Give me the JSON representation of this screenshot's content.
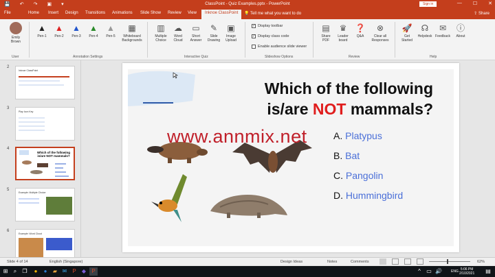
{
  "window": {
    "title": "ClassPoint - Quiz Examples.pptx - PowerPoint",
    "signin": "Sign in",
    "minimize": "—",
    "maximize": "☐",
    "close": "✕"
  },
  "qat": [
    "💾",
    "↶",
    "↷",
    "▣",
    "▾"
  ],
  "tabs": [
    "File",
    "Home",
    "Insert",
    "Design",
    "Transitions",
    "Animations",
    "Slide Show",
    "Review",
    "View",
    "Inknoe ClassPoint"
  ],
  "active_tab": "Inknoe ClassPoint",
  "tell_me": "Tell me what you want to do",
  "share": "Share",
  "ribbon": {
    "user": {
      "name_line1": "Emily",
      "name_line2": "Brown",
      "group": "User"
    },
    "annotation": {
      "pens": [
        "Pen-1",
        "Pen-2",
        "Pen-3",
        "Pen-4",
        "Pen-5"
      ],
      "whiteboard_line1": "Whiteboard",
      "whiteboard_line2": "Backgrounds",
      "group": "Annotation Settings"
    },
    "interactive": {
      "buttons": [
        {
          "line1": "Multiple",
          "line2": "Choice"
        },
        {
          "line1": "Word",
          "line2": "Cloud"
        },
        {
          "line1": "Short",
          "line2": "Answer"
        },
        {
          "line1": "Slide",
          "line2": "Drawing"
        },
        {
          "line1": "Image",
          "line2": "Upload"
        }
      ],
      "group": "Interactive Quiz"
    },
    "slideshow": {
      "options": [
        {
          "label": "Display toolbar",
          "checked": "✓"
        },
        {
          "label": "Display class code",
          "checked": "✓"
        },
        {
          "label": "Enable audience slide viewer",
          "checked": ""
        }
      ],
      "group": "Slideshow Options"
    },
    "review": {
      "buttons": [
        {
          "line1": "Share",
          "line2": "PDF"
        },
        {
          "line1": "Leader",
          "line2": "board"
        },
        {
          "line1": "Q&A",
          "line2": ""
        },
        {
          "line1": "Clear all",
          "line2": "Responses"
        }
      ],
      "group": "Review"
    },
    "help": {
      "buttons": [
        {
          "line1": "Get",
          "line2": "Started"
        },
        {
          "line1": "Helpdesk",
          "line2": ""
        },
        {
          "line1": "Feedback",
          "line2": ""
        },
        {
          "line1": "About",
          "line2": ""
        }
      ],
      "group": "Help"
    }
  },
  "thumbnails": [
    {
      "num": "2",
      "title": "Inknoe ClassPoint"
    },
    {
      "num": "3",
      "title": "Play Icon Key"
    },
    {
      "num": "4",
      "title": "Which of the following is/are NOT mammals?"
    },
    {
      "num": "5",
      "title": "Example: Multiple Choice"
    },
    {
      "num": "6",
      "title": "Example: Word Cloud"
    }
  ],
  "slide": {
    "question_line1": "Which of the following",
    "question_line2_pre": "is/are ",
    "question_not": "NOT",
    "question_line2_post": " mammals?",
    "options": [
      {
        "letter": "A. ",
        "text": "Platypus"
      },
      {
        "letter": "B. ",
        "text": "Bat"
      },
      {
        "letter": "C. ",
        "text": "Pangolin"
      },
      {
        "letter": "D. ",
        "text": "Hummingbird"
      }
    ]
  },
  "watermark": "www.annmix.net",
  "statusbar": {
    "slide_info": "Slide 4 of 14",
    "language": "English (Singapore)",
    "accessibility": "Design Ideas",
    "notes": "Notes",
    "comments": "Comments",
    "zoom": "62%"
  },
  "taskbar": {
    "lang": "ENG",
    "time": "5:06 PM",
    "date": "2/10/2021"
  }
}
